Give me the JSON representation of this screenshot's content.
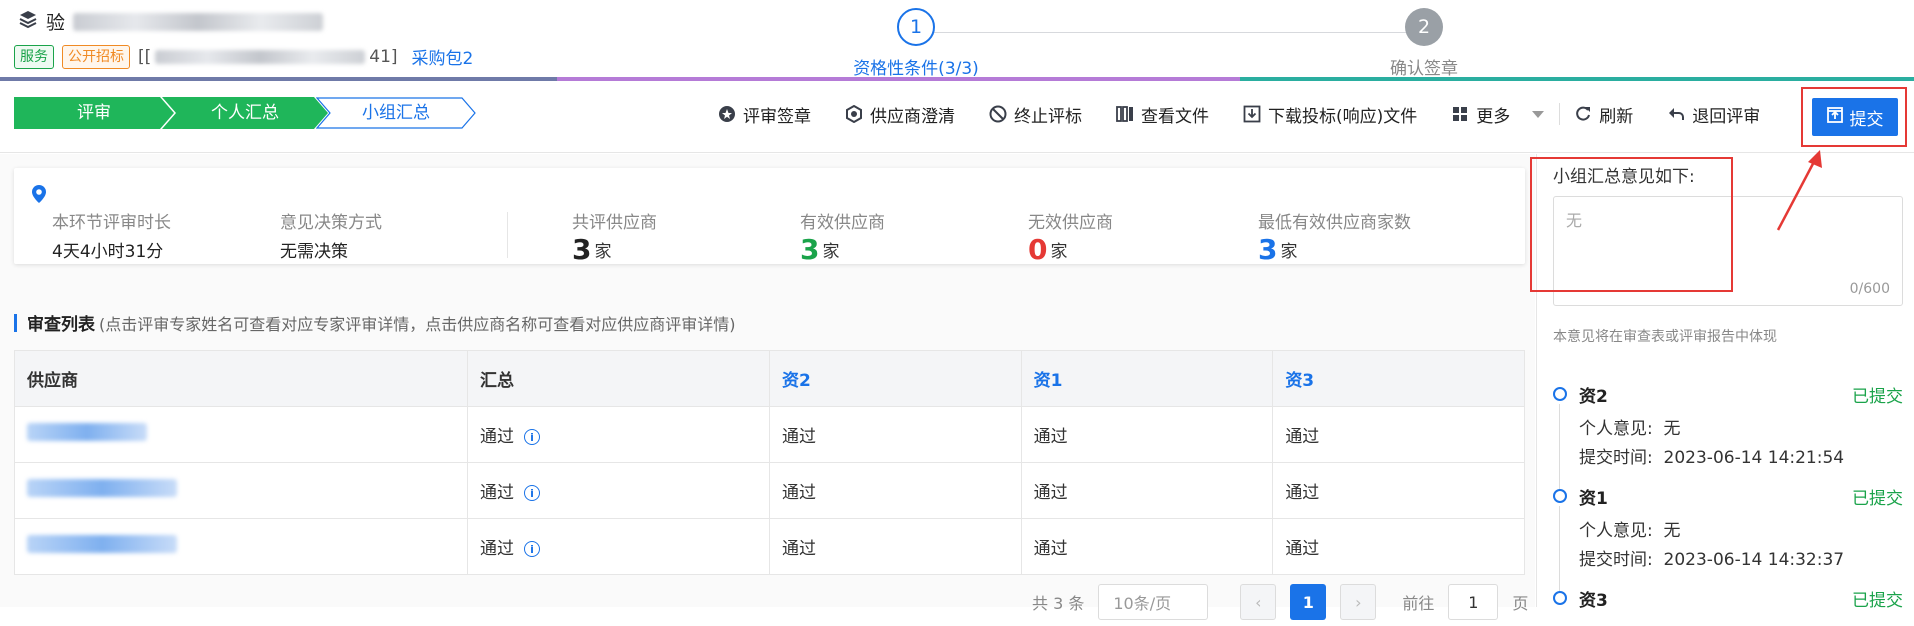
{
  "header": {
    "title_prefix": "验",
    "tags": [
      "服务",
      "公开招标"
    ],
    "code_open": "[[",
    "code_close": "41]",
    "package": "采购包2"
  },
  "steps": [
    {
      "index": "1",
      "label": "资格性条件(3/3)",
      "active": true
    },
    {
      "index": "2",
      "label": "确认签章",
      "active": false
    }
  ],
  "breadcrumb": [
    "评审",
    "个人汇总",
    "小组汇总"
  ],
  "actions": {
    "sign": "评审签章",
    "clarify": "供应商澄清",
    "terminate": "终止评标",
    "view_files": "查看文件",
    "download": "下载投标(响应)文件",
    "more": "更多",
    "refresh": "刷新",
    "return": "退回评审",
    "submit": "提交"
  },
  "stats": {
    "duration_label": "本环节评审时长",
    "duration_value": "4天4小时31分",
    "method_label": "意见决策方式",
    "method_value": "无需决策",
    "total_label": "共评供应商",
    "total_value": "3",
    "valid_label": "有效供应商",
    "valid_value": "3",
    "invalid_label": "无效供应商",
    "invalid_value": "0",
    "min_label": "最低有效供应商家数",
    "min_value": "3",
    "unit": "家"
  },
  "list": {
    "title": "审查列表",
    "hint": "(点击评审专家姓名可查看对应专家评审详情，点击供应商名称可查看对应供应商评审详情)",
    "columns": [
      "供应商",
      "汇总",
      "资2",
      "资1",
      "资3"
    ],
    "rows": [
      {
        "summary": "通过",
        "c1": "通过",
        "c2": "通过",
        "c3": "通过"
      },
      {
        "summary": "通过",
        "c1": "通过",
        "c2": "通过",
        "c3": "通过"
      },
      {
        "summary": "通过",
        "c1": "通过",
        "c2": "通过",
        "c3": "通过"
      }
    ]
  },
  "pager": {
    "total": "共 3 条",
    "page_size": "10条/页",
    "current": "1",
    "goto": "前往",
    "goto_value": "1",
    "page_unit": "页"
  },
  "side": {
    "label": "小组汇总意见如下:",
    "placeholder": "无",
    "counter": "0/600",
    "note": "本意见将在审查表或评审报告中体现",
    "timeline": [
      {
        "name": "资2",
        "status": "已提交",
        "opinion_label": "个人意见:",
        "opinion": "无",
        "time_label": "提交时间:",
        "time": "2023-06-14 14:21:54"
      },
      {
        "name": "资1",
        "status": "已提交",
        "opinion_label": "个人意见:",
        "opinion": "无",
        "time_label": "提交时间:",
        "time": "2023-06-14 14:32:37"
      },
      {
        "name": "资3",
        "status": "已提交"
      }
    ]
  },
  "colors": {
    "primary": "#1a73e8",
    "green": "#1aa34a",
    "red": "#e53935",
    "orange": "#f08a24"
  }
}
